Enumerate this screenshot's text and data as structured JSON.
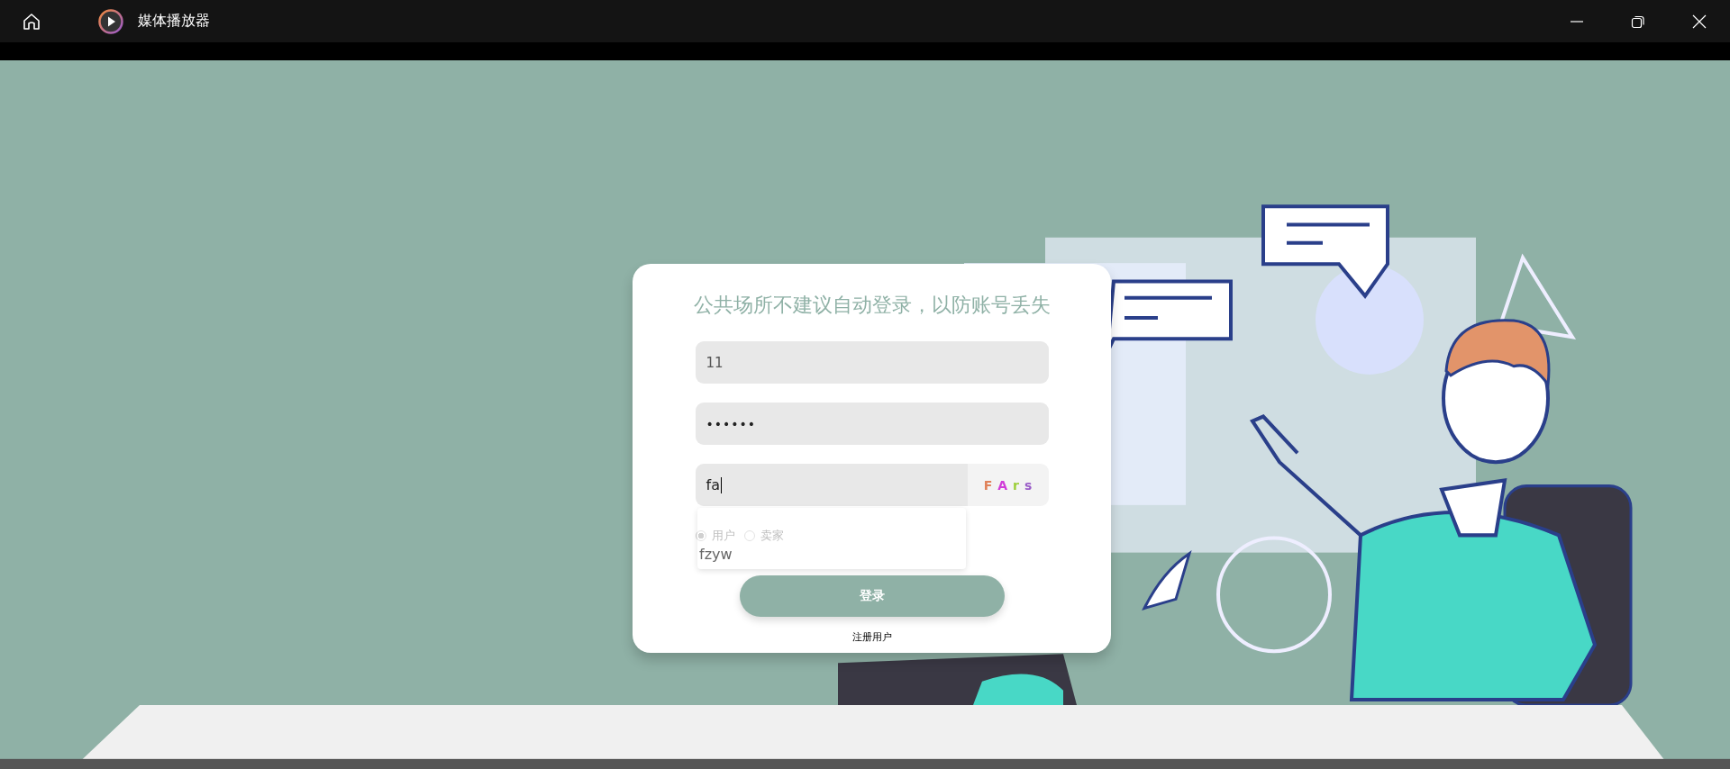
{
  "window": {
    "title": "媒体播放器"
  },
  "login": {
    "notice": "公共场所不建议自动登录，以防账号丢失",
    "username": {
      "value": "11"
    },
    "password": {
      "value": "••••••"
    },
    "captcha": {
      "value": "fa",
      "chars": [
        {
          "text": "F",
          "color": "#e0825a"
        },
        {
          "text": "A",
          "color": "#d03cd8"
        },
        {
          "text": "r",
          "color": "#9ccf3a"
        },
        {
          "text": "s",
          "color": "#9a5cc8"
        }
      ]
    },
    "autocomplete": [
      "fzyw"
    ],
    "roles": [
      {
        "label": "用户",
        "selected": true
      },
      {
        "label": "卖家",
        "selected": false
      }
    ],
    "submit": "登录",
    "register": "注册用户"
  }
}
